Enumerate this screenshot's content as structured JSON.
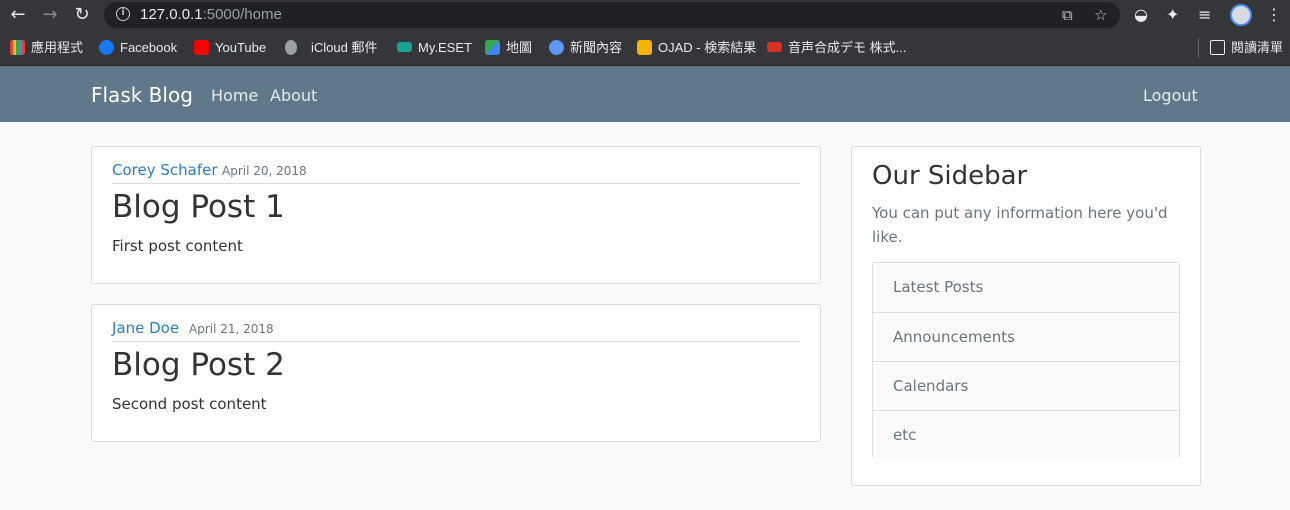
{
  "browser": {
    "url_host": "127.0.0.1",
    "url_rest": ":5000/home",
    "bookmarks": [
      {
        "label": "應用程式",
        "color": "#e67e22"
      },
      {
        "label": "Facebook",
        "color": "#1877f2"
      },
      {
        "label": "YouTube",
        "color": "#ff0000"
      },
      {
        "label": "iCloud 郵件",
        "color": "#9aa0a6"
      },
      {
        "label": "My.ESET",
        "color": "#1aa295"
      },
      {
        "label": "地圖",
        "color": "#34a853"
      },
      {
        "label": "新聞內容",
        "color": "#5e97f6"
      },
      {
        "label": "OJAD - 検索結果",
        "color": "#f5b400"
      },
      {
        "label": "音声合成デモ 株式...",
        "color": "#d93025"
      }
    ],
    "reading_list": "閱讀清單"
  },
  "navbar": {
    "brand": "Flask Blog",
    "links": [
      "Home",
      "About"
    ],
    "logout": "Logout"
  },
  "posts": [
    {
      "author": "Corey Schafer",
      "date": "April 20, 2018",
      "title": "Blog Post 1",
      "content": "First post content"
    },
    {
      "author": "Jane Doe",
      "date": "April 21, 2018",
      "title": "Blog Post 2",
      "content": "Second post content"
    }
  ],
  "sidebar": {
    "title": "Our Sidebar",
    "description": "You can put any information here you'd like.",
    "items": [
      "Latest Posts",
      "Announcements",
      "Calendars",
      "etc"
    ]
  }
}
